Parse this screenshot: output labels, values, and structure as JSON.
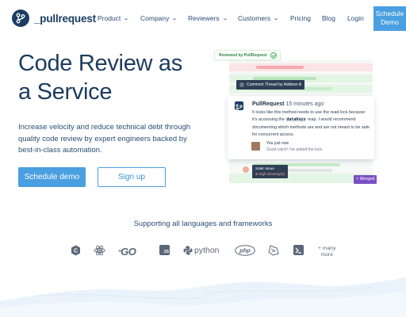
{
  "nav": {
    "brand": "_pullrequest",
    "items": [
      {
        "label": "Product",
        "dropdown": true
      },
      {
        "label": "Company",
        "dropdown": true
      },
      {
        "label": "Reviewers",
        "dropdown": true
      },
      {
        "label": "Customers",
        "dropdown": true
      },
      {
        "label": "Pricing",
        "dropdown": false
      },
      {
        "label": "Blog",
        "dropdown": false
      },
      {
        "label": "Login",
        "dropdown": false
      }
    ],
    "cta_line1": "Schedule",
    "cta_line2": "Demo",
    "icons": {
      "logo": "branch-icon",
      "dropdown": "chevron-down-icon"
    }
  },
  "hero": {
    "title_line1": "Code Review as",
    "title_line2": "a Service",
    "subtitle": "Increase velocity and reduce technical debt through quality code review by expert engineers backed by best-in-class automation.",
    "primary_button": "Schedule demo",
    "secondary_button": "Sign up"
  },
  "illustration": {
    "reviewed_badge": "Reviewed by PullRequest",
    "thread_header": "Comment Thread by Addison A",
    "comment": {
      "author": "PullRequest",
      "time": "15 minutes ago",
      "text_before": "It locks like this method needs to use the read lock because it's accessing the",
      "keyword": "dataKeys",
      "text_after": "map. I would recommend documenting which methods are and are not meant to be safe for concurrent access."
    },
    "reply": {
      "author": "You just now",
      "text": "Good catch! I've added the lock."
    },
    "static_issue_line1": "Static Issue",
    "static_issue_line2": "● High Severity(3)",
    "merged": "Merged",
    "colors": {
      "removed": "#f4c7cc",
      "added": "#c7ecc9",
      "thread": "#2e3f55",
      "merged": "#7b4fc4"
    }
  },
  "languages": {
    "title": "Supporting all languages and frameworks",
    "items": [
      {
        "name": "c-icon",
        "label": "C"
      },
      {
        "name": "react-icon",
        "label": ""
      },
      {
        "name": "go-icon",
        "label": "GO"
      },
      {
        "name": "js-icon",
        "label": "JS"
      },
      {
        "name": "python-icon",
        "label": "python"
      },
      {
        "name": "php-icon",
        "label": "php"
      },
      {
        "name": "swift-icon",
        "label": ""
      },
      {
        "name": "kotlin-icon",
        "label": ""
      }
    ],
    "more_line1": "+ many",
    "more_line2": "more"
  },
  "theme": {
    "accent": "#4a9fe0",
    "navy": "#1c3b5e"
  }
}
